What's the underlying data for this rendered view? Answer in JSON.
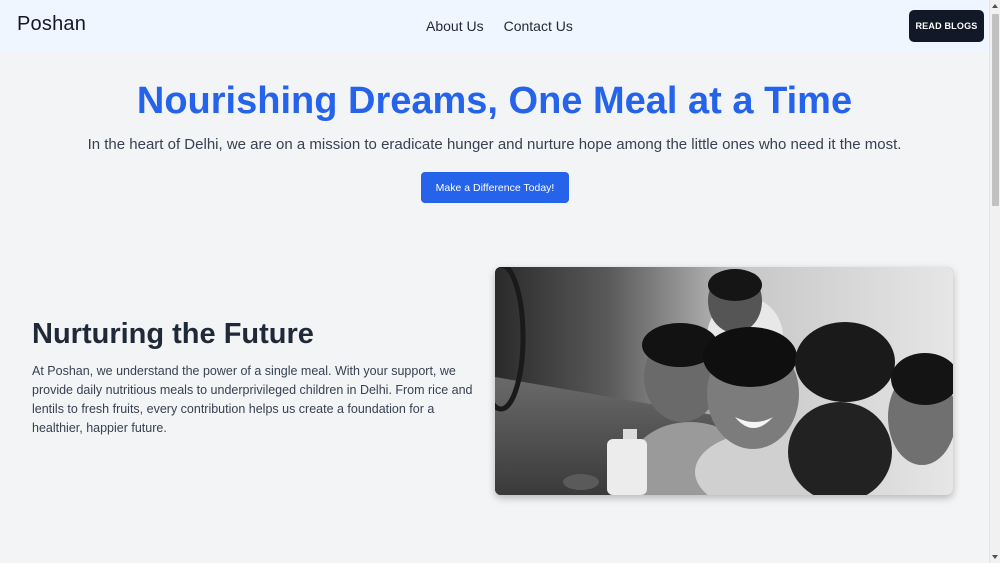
{
  "navbar": {
    "brand": "Poshan",
    "links": [
      "About Us",
      "Contact Us"
    ],
    "cta_label": "READ BLOGS"
  },
  "hero": {
    "title": "Nourishing Dreams, One Meal at a Time",
    "subtitle": "In the heart of Delhi, we are on a mission to eradicate hunger and nurture hope among the little ones who need it the most.",
    "cta_label": "Make a Difference Today!"
  },
  "feature": {
    "title": "Nurturing the Future",
    "text": "At Poshan, we understand the power of a single meal. With your support, we provide daily nutritious meals to underprivileged children in Delhi. From rice and lentils to fresh fruits, every contribution helps us create a foundation for a healthier, happier future.",
    "image_alt": "children-eating-photo"
  },
  "colors": {
    "primary": "#2563eb",
    "dark": "#111827",
    "navbar_bg": "#eff6ff",
    "page_bg": "#f3f4f6"
  }
}
